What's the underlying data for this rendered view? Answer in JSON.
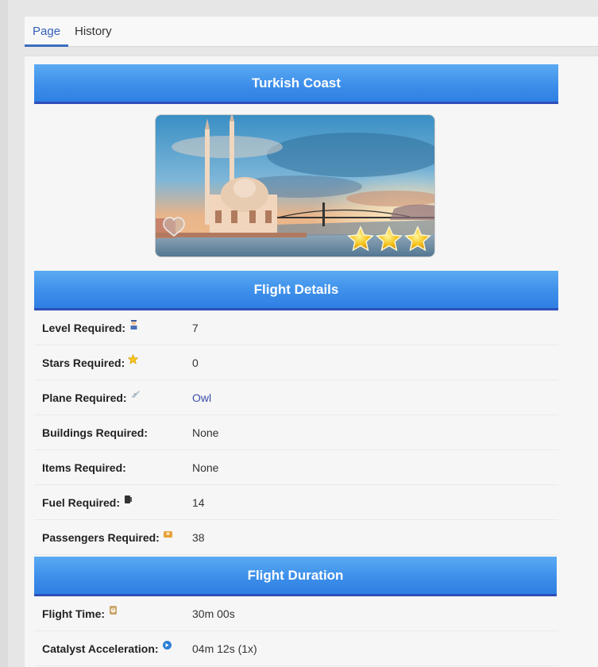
{
  "tabs": [
    {
      "label": "Page"
    },
    {
      "label": "History"
    }
  ],
  "title": "Turkish Coast",
  "hero": {
    "stars": 3
  },
  "flight_details": {
    "header": "Flight Details",
    "rows": [
      {
        "label": "Level Required:",
        "icon": "pilot-icon",
        "value": "7"
      },
      {
        "label": "Stars Required:",
        "icon": "star-icon",
        "value": "0"
      },
      {
        "label": "Plane Required:",
        "icon": "plane-icon",
        "value": "Owl"
      },
      {
        "label": "Buildings Required:",
        "icon": "",
        "value": "None"
      },
      {
        "label": "Items Required:",
        "icon": "",
        "value": "None"
      },
      {
        "label": "Fuel Required:",
        "icon": "fuel-icon",
        "value": "14"
      },
      {
        "label": "Passengers Required:",
        "icon": "passenger-icon",
        "value": "38"
      }
    ]
  },
  "flight_duration": {
    "header": "Flight Duration",
    "rows": [
      {
        "label": "Flight Time:",
        "icon": "clock-icon",
        "value": "30m 00s"
      },
      {
        "label": "Catalyst Acceleration:",
        "icon": "catalyst-icon",
        "value": "04m 12s (1x)"
      }
    ]
  },
  "colors": {
    "header_blue": "#3d8fea",
    "header_border": "#2e4fb8",
    "link": "#3b4ea8",
    "active_tab": "#3461b8"
  }
}
